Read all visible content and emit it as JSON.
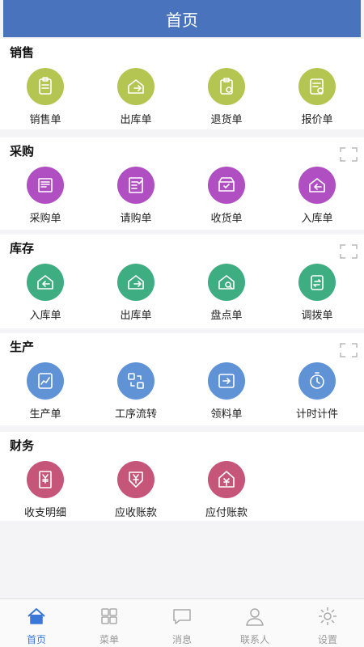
{
  "header": {
    "title": "首页"
  },
  "sections": [
    {
      "title": "销售",
      "color": "#b5c552",
      "items": [
        {
          "label": "销售单",
          "icon": "clipboard-list-icon"
        },
        {
          "label": "出库单",
          "icon": "house-out-icon"
        },
        {
          "label": "退货单",
          "icon": "return-goods-icon"
        },
        {
          "label": "报价单",
          "icon": "quote-icon"
        }
      ]
    },
    {
      "title": "采购",
      "color": "#b04fc2",
      "items": [
        {
          "label": "采购单",
          "icon": "purchase-doc-icon"
        },
        {
          "label": "请购单",
          "icon": "request-list-icon"
        },
        {
          "label": "收货单",
          "icon": "inbox-check-icon"
        },
        {
          "label": "入库单",
          "icon": "house-in-icon"
        }
      ]
    },
    {
      "title": "库存",
      "color": "#3eae82",
      "items": [
        {
          "label": "入库单",
          "icon": "house-in-icon"
        },
        {
          "label": "出库单",
          "icon": "house-out-icon"
        },
        {
          "label": "盘点单",
          "icon": "inventory-search-icon"
        },
        {
          "label": "调拨单",
          "icon": "transfer-icon"
        }
      ]
    },
    {
      "title": "生产",
      "color": "#5f93d6",
      "items": [
        {
          "label": "生产单",
          "icon": "chart-doc-icon"
        },
        {
          "label": "工序流转",
          "icon": "process-flow-icon"
        },
        {
          "label": "领料单",
          "icon": "material-out-icon"
        },
        {
          "label": "计时计件",
          "icon": "timer-icon"
        }
      ]
    },
    {
      "title": "财务",
      "color": "#c65679",
      "items": [
        {
          "label": "收支明细",
          "icon": "yen-doc-icon"
        },
        {
          "label": "应收账款",
          "icon": "yen-receive-icon"
        },
        {
          "label": "应付账款",
          "icon": "yen-pay-icon"
        }
      ]
    }
  ],
  "tabbar": [
    {
      "label": "首页",
      "icon": "home-icon",
      "active": true
    },
    {
      "label": "菜单",
      "icon": "grid-menu-icon",
      "active": false
    },
    {
      "label": "消息",
      "icon": "message-icon",
      "active": false
    },
    {
      "label": "联系人",
      "icon": "contact-icon",
      "active": false
    },
    {
      "label": "设置",
      "icon": "settings-icon",
      "active": false
    }
  ],
  "colors": {
    "header": "#4a73bd",
    "tab_active": "#3a78d8",
    "tab_inactive": "#999999"
  }
}
